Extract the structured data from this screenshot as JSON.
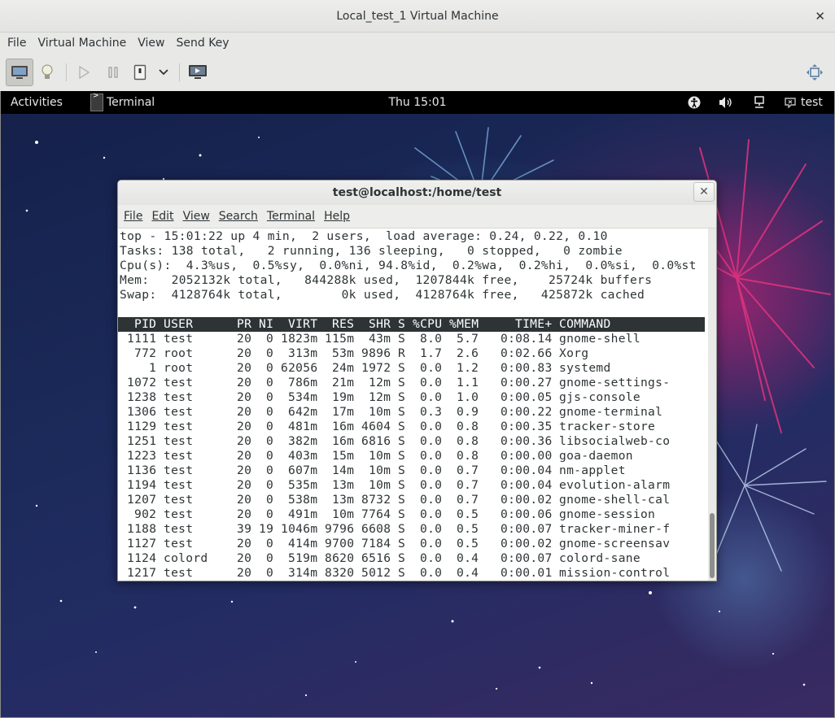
{
  "vm": {
    "title": "Local_test_1 Virtual Machine",
    "close_glyph": "✕",
    "menu": [
      "File",
      "Virtual Machine",
      "View",
      "Send Key"
    ]
  },
  "topbar": {
    "activities": "Activities",
    "app_name": "Terminal",
    "clock": "Thu 15:01",
    "user": "test"
  },
  "terminal": {
    "title": "test@localhost:/home/test",
    "close_glyph": "✕",
    "menu": [
      "File",
      "Edit",
      "View",
      "Search",
      "Terminal",
      "Help"
    ],
    "summary": [
      "top - 15:01:22 up 4 min,  2 users,  load average: 0.24, 0.22, 0.10",
      "Tasks: 138 total,   2 running, 136 sleeping,   0 stopped,   0 zombie",
      "Cpu(s):  4.3%us,  0.5%sy,  0.0%ni, 94.8%id,  0.2%wa,  0.2%hi,  0.0%si,  0.0%st",
      "Mem:   2052132k total,   844288k used,  1207844k free,    25724k buffers",
      "Swap:  4128764k total,        0k used,  4128764k free,   425872k cached"
    ],
    "columns": [
      "PID",
      "USER",
      "PR",
      "NI",
      "VIRT",
      "RES",
      "SHR",
      "S",
      "%CPU",
      "%MEM",
      "TIME+",
      "COMMAND"
    ],
    "processes": [
      [
        "1111",
        "test",
        "20",
        "0",
        "1823m",
        "115m",
        "43m",
        "S",
        "8.0",
        "5.7",
        "0:08.14",
        "gnome-shell"
      ],
      [
        "772",
        "root",
        "20",
        "0",
        "313m",
        "53m",
        "9896",
        "R",
        "1.7",
        "2.6",
        "0:02.66",
        "Xorg"
      ],
      [
        "1",
        "root",
        "20",
        "0",
        "62056",
        "24m",
        "1972",
        "S",
        "0.0",
        "1.2",
        "0:00.83",
        "systemd"
      ],
      [
        "1072",
        "test",
        "20",
        "0",
        "786m",
        "21m",
        "12m",
        "S",
        "0.0",
        "1.1",
        "0:00.27",
        "gnome-settings-"
      ],
      [
        "1238",
        "test",
        "20",
        "0",
        "534m",
        "19m",
        "12m",
        "S",
        "0.0",
        "1.0",
        "0:00.05",
        "gjs-console"
      ],
      [
        "1306",
        "test",
        "20",
        "0",
        "642m",
        "17m",
        "10m",
        "S",
        "0.3",
        "0.9",
        "0:00.22",
        "gnome-terminal"
      ],
      [
        "1129",
        "test",
        "20",
        "0",
        "481m",
        "16m",
        "4604",
        "S",
        "0.0",
        "0.8",
        "0:00.35",
        "tracker-store"
      ],
      [
        "1251",
        "test",
        "20",
        "0",
        "382m",
        "16m",
        "6816",
        "S",
        "0.0",
        "0.8",
        "0:00.36",
        "libsocialweb-co"
      ],
      [
        "1223",
        "test",
        "20",
        "0",
        "403m",
        "15m",
        "10m",
        "S",
        "0.0",
        "0.8",
        "0:00.00",
        "goa-daemon"
      ],
      [
        "1136",
        "test",
        "20",
        "0",
        "607m",
        "14m",
        "10m",
        "S",
        "0.0",
        "0.7",
        "0:00.04",
        "nm-applet"
      ],
      [
        "1194",
        "test",
        "20",
        "0",
        "535m",
        "13m",
        "10m",
        "S",
        "0.0",
        "0.7",
        "0:00.04",
        "evolution-alarm"
      ],
      [
        "1207",
        "test",
        "20",
        "0",
        "538m",
        "13m",
        "8732",
        "S",
        "0.0",
        "0.7",
        "0:00.02",
        "gnome-shell-cal"
      ],
      [
        "902",
        "test",
        "20",
        "0",
        "491m",
        "10m",
        "7764",
        "S",
        "0.0",
        "0.5",
        "0:00.06",
        "gnome-session"
      ],
      [
        "1188",
        "test",
        "39",
        "19",
        "1046m",
        "9796",
        "6608",
        "S",
        "0.0",
        "0.5",
        "0:00.07",
        "tracker-miner-f"
      ],
      [
        "1127",
        "test",
        "20",
        "0",
        "414m",
        "9700",
        "7184",
        "S",
        "0.0",
        "0.5",
        "0:00.02",
        "gnome-screensav"
      ],
      [
        "1124",
        "colord",
        "20",
        "0",
        "519m",
        "8620",
        "6516",
        "S",
        "0.0",
        "0.4",
        "0:00.07",
        "colord-sane"
      ],
      [
        "1217",
        "test",
        "20",
        "0",
        "314m",
        "8320",
        "5012",
        "S",
        "0.0",
        "0.4",
        "0:00.01",
        "mission-control"
      ]
    ]
  },
  "colors": {
    "term_fg": "#2e3436",
    "header_bg": "#2e3436",
    "topbar_bg": "#000000"
  }
}
